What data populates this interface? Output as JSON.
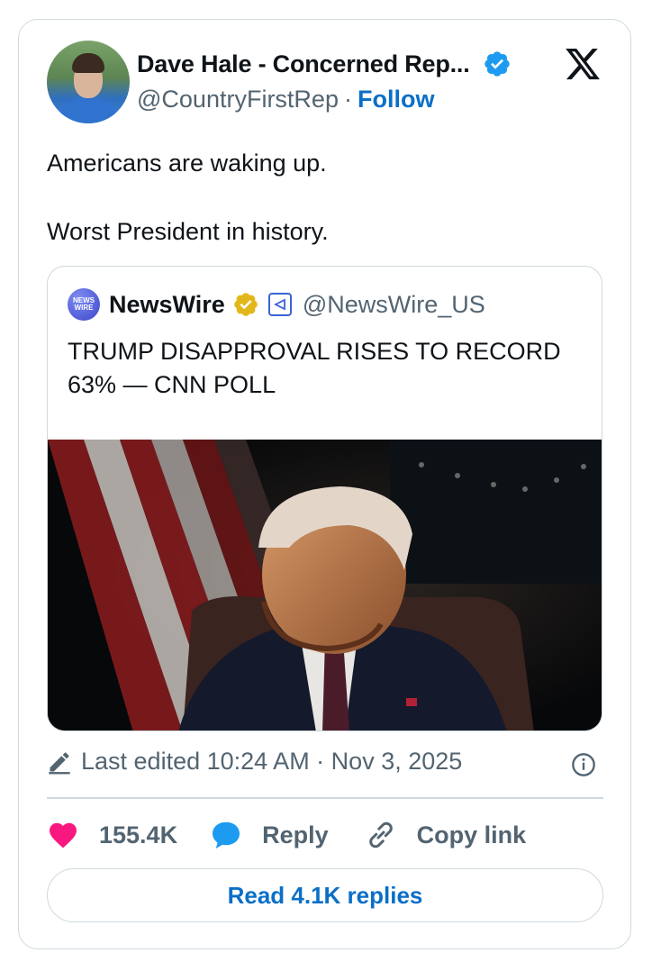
{
  "author": {
    "display_name": "Dave Hale - Concerned Rep...",
    "handle": "@CountryFirstRep",
    "separator": "·",
    "follow_label": "Follow",
    "verified_color": "#1d9bf0"
  },
  "tweet": {
    "lines": [
      "Americans are waking up.",
      "Worst President in history."
    ]
  },
  "quote": {
    "logo_text": [
      "NEWS",
      "WIRE"
    ],
    "name": "NewsWire",
    "handle": "@NewsWire_US",
    "text": "TRUMP DISAPPROVAL RISES TO RECORD 63% — CNN POLL",
    "badge_color": "#e2b719"
  },
  "meta": {
    "edited": "Last edited 10:24 AM · Nov 3, 2025"
  },
  "actions": {
    "likes": "155.4K",
    "reply_label": "Reply",
    "copy_label": "Copy link",
    "read_replies": "Read 4.1K replies"
  },
  "icons": {
    "x_logo": "x-logo-icon",
    "pencil": "pencil-icon",
    "info": "info-icon",
    "heart": "heart-icon",
    "reply": "reply-bubble-icon",
    "link": "link-icon"
  },
  "colors": {
    "accent": "#0b6fc7",
    "heart": "#f91880",
    "reply": "#1d9bf0",
    "muted": "#536471"
  }
}
